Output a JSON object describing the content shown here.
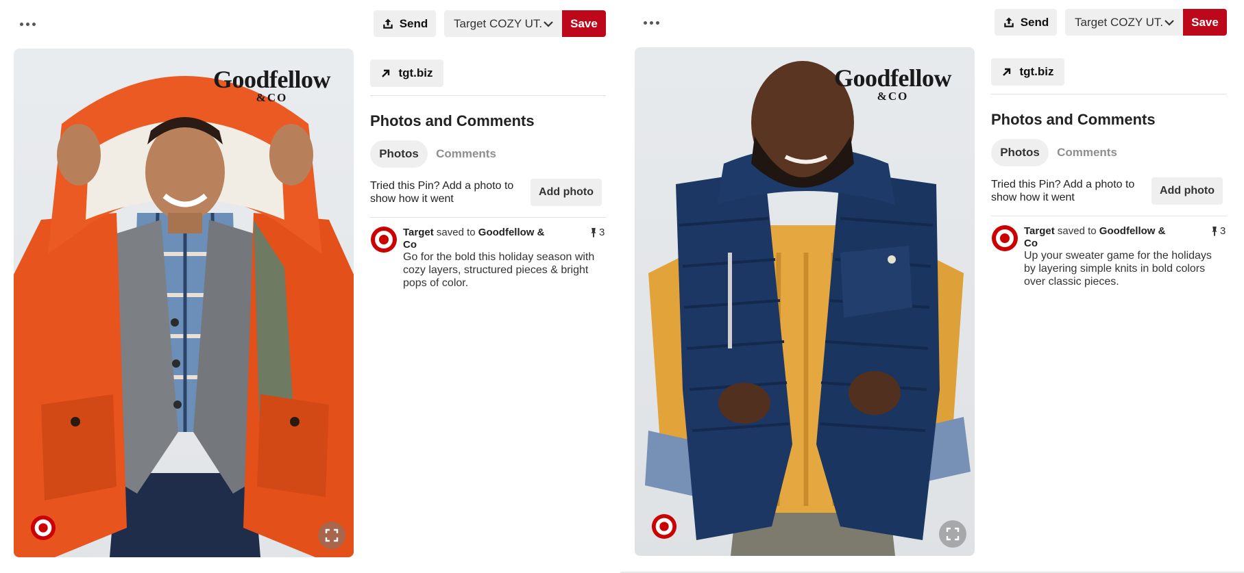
{
  "pins": [
    {
      "send_label": "Send",
      "board_label": "Target COZY UT...",
      "save_label": "Save",
      "brand_name": "Goodfellow",
      "brand_co": "&CO",
      "link_label": "tgt.biz",
      "section_title": "Photos and Comments",
      "tabs": [
        {
          "label": "Photos"
        },
        {
          "label": "Comments"
        }
      ],
      "tried_text": "Tried this Pin? Add a photo to show how it went",
      "add_photo_label": "Add photo",
      "saver": "Target",
      "saved_to": "saved to",
      "board_name": "Goodfellow & Co",
      "pin_count": "3",
      "description": "Go for the bold this holiday season with cozy layers, structured pieces & bright pops of color."
    },
    {
      "send_label": "Send",
      "board_label": "Target COZY UT...",
      "save_label": "Save",
      "brand_name": "Goodfellow",
      "brand_co": "&CO",
      "link_label": "tgt.biz",
      "section_title": "Photos and Comments",
      "tabs": [
        {
          "label": "Photos"
        },
        {
          "label": "Comments"
        }
      ],
      "tried_text": "Tried this Pin? Add a photo to show how it went",
      "add_photo_label": "Add photo",
      "saver": "Target",
      "saved_to": "saved to",
      "board_name": "Goodfellow & Co",
      "pin_count": "3",
      "description": "Up your sweater game for the holidays by layering simple knits in bold colors over classic pieces."
    }
  ],
  "colors": {
    "save_red": "#bd081c",
    "target_red": "#cc0000",
    "button_gray": "#efefef"
  },
  "icons": {
    "more": "more-horizontal-icon",
    "send": "share-upload-icon",
    "dropdown": "chevron-down-icon",
    "link": "arrow-up-right-icon",
    "pin": "pushpin-icon",
    "expand": "expand-icon",
    "target_logo": "target-bullseye-icon"
  }
}
